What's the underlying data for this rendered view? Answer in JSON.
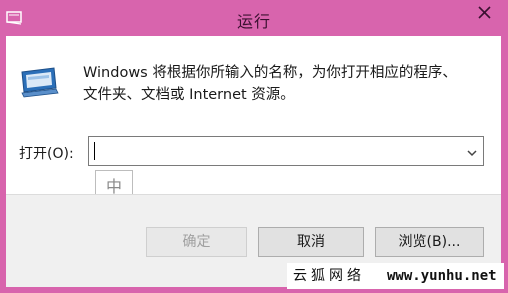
{
  "window": {
    "title": "运行",
    "frame_color": "#d864ad",
    "icon": "run-app-icon"
  },
  "titlebar": {
    "close_icon": "close-icon"
  },
  "dialog": {
    "description_line1": "Windows 将根据你所输入的名称，为你打开相应的程序、",
    "description_line2": "文件夹、文档或 Internet 资源。",
    "open_label": "打开(O):",
    "open_value": "",
    "dropdown_icon": "chevron-down-icon",
    "ime_indicator": "中"
  },
  "buttons": {
    "ok": "确定",
    "ok_enabled": false,
    "cancel": "取消",
    "browse": "浏览(B)..."
  },
  "watermark": {
    "site_name": "云狐网络",
    "url": "www.yunhu.net"
  }
}
